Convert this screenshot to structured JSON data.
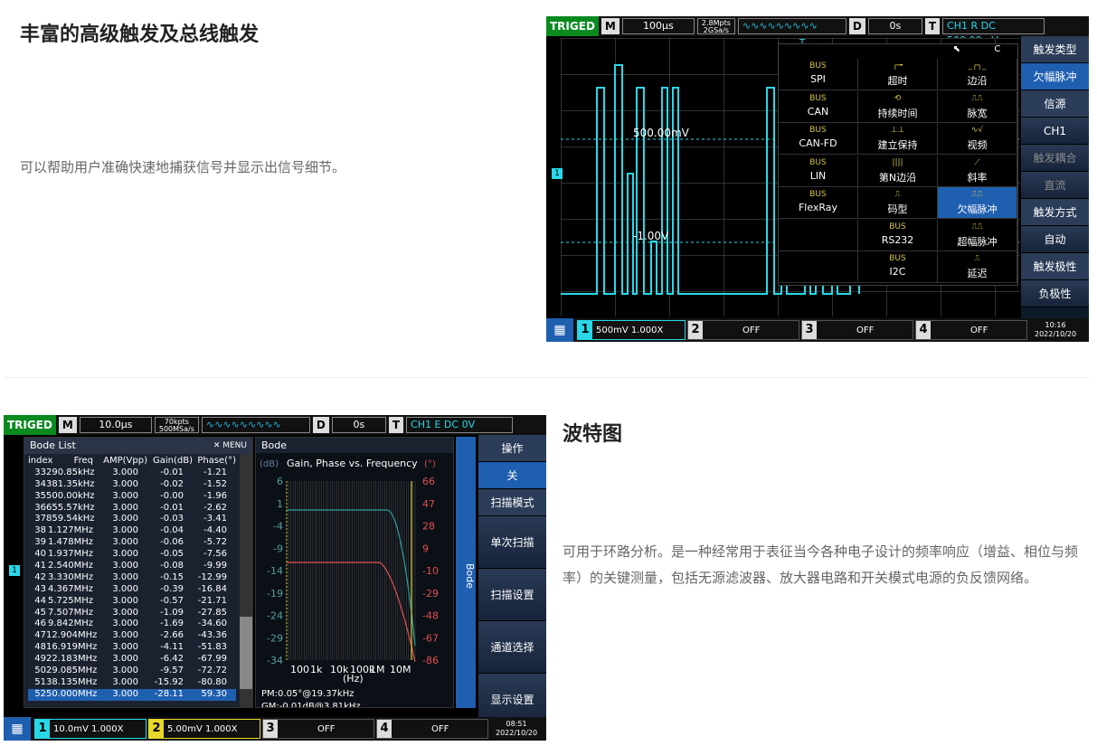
{
  "section1": {
    "title": "丰富的高级触发及总线触发",
    "desc": "可以帮助用户准确快速地捕获信号并显示出信号细节。"
  },
  "section2": {
    "title": "波特图",
    "desc": "可用于环路分析。是一种经常用于表征当今各种电子设计的频率响应（增益、相位与频率）的关键测量，包括无源滤波器、放大器电路和开关模式电源的负反馈网络。"
  },
  "scope1": {
    "top": {
      "status": "TRIGED",
      "mode": "M",
      "timebase": "100µs",
      "mem": "2.8Mpts",
      "rate": "2GSa/s",
      "delay_label": "D",
      "delay": "0s",
      "trig_label": "T",
      "trig_info": "CH1 R DC 500.00mV"
    },
    "levels": {
      "upper": "500.00mV",
      "lower": "-1.00V"
    },
    "menu_top": [
      "⬉",
      "C"
    ],
    "menu_items": [
      {
        "icon": "BUS",
        "label": "SPI"
      },
      {
        "icon": "┌╼",
        "label": "超时"
      },
      {
        "icon": "_┌┐_",
        "label": "边沿"
      },
      {
        "icon": "BUS",
        "label": "CAN"
      },
      {
        "icon": "⟲",
        "label": "持续时间"
      },
      {
        "icon": "⎍⎍",
        "label": "脉宽"
      },
      {
        "icon": "BUS",
        "label": "CAN-FD"
      },
      {
        "icon": "⊥⊥",
        "label": "建立保持"
      },
      {
        "icon": "∿√",
        "label": "视频"
      },
      {
        "icon": "BUS",
        "label": "LIN"
      },
      {
        "icon": "||||",
        "label": "第N边沿"
      },
      {
        "icon": "⟋",
        "label": "斜率"
      },
      {
        "icon": "BUS",
        "label": "FlexRay"
      },
      {
        "icon": "⎍",
        "label": "码型"
      },
      {
        "icon": "⎍⎍",
        "label": "欠幅脉冲",
        "selected": true
      },
      {
        "icon": "",
        "label": ""
      },
      {
        "icon": "BUS",
        "label": "RS232"
      },
      {
        "icon": "⎍⎍",
        "label": "超幅脉冲"
      },
      {
        "icon": "",
        "label": ""
      },
      {
        "icon": "BUS",
        "label": "I2C"
      },
      {
        "icon": "⎍",
        "label": "延迟"
      }
    ],
    "side": [
      {
        "t": "触发类型",
        "k": "h"
      },
      {
        "t": "欠幅脉冲",
        "k": "a"
      },
      {
        "t": "信源",
        "k": "h"
      },
      {
        "t": "CH1",
        "k": ""
      },
      {
        "t": "触发耦合",
        "k": "d"
      },
      {
        "t": "直流",
        "k": "d"
      },
      {
        "t": "触发方式",
        "k": "h"
      },
      {
        "t": "自动",
        "k": ""
      },
      {
        "t": "触发极性",
        "k": "h"
      },
      {
        "t": "负极性",
        "k": ""
      }
    ],
    "bottom": {
      "ch1": "500mV 1.000X",
      "ch2": "OFF",
      "ch3": "OFF",
      "ch4": "OFF",
      "time": "10:16",
      "date": "2022/10/20"
    }
  },
  "scope2": {
    "top": {
      "status": "TRIGED",
      "mode": "M",
      "timebase": "10.0µs",
      "mem": "70kpts",
      "rate": "500MSa/s",
      "delay_label": "D",
      "delay": "0s",
      "trig_label": "T",
      "trig_info": "CH1 E DC 0V"
    },
    "list_title": "Bode List",
    "menu_label": "MENU",
    "cols": [
      "index",
      "Freq",
      "AMP(Vpp)",
      "Gain(dB)",
      "Phase(°)"
    ],
    "rows": [
      [
        "33",
        "290.85kHz",
        "3.000",
        "-0.01",
        "-1.21"
      ],
      [
        "34",
        "381.35kHz",
        "3.000",
        "-0.02",
        "-1.52"
      ],
      [
        "35",
        "500.00kHz",
        "3.000",
        "-0.00",
        "-1.96"
      ],
      [
        "36",
        "655.57kHz",
        "3.000",
        "-0.01",
        "-2.62"
      ],
      [
        "37",
        "859.54kHz",
        "3.000",
        "-0.03",
        "-3.41"
      ],
      [
        "38",
        "1.127MHz",
        "3.000",
        "-0.04",
        "-4.40"
      ],
      [
        "39",
        "1.478MHz",
        "3.000",
        "-0.06",
        "-5.72"
      ],
      [
        "40",
        "1.937MHz",
        "3.000",
        "-0.05",
        "-7.56"
      ],
      [
        "41",
        "2.540MHz",
        "3.000",
        "-0.08",
        "-9.99"
      ],
      [
        "42",
        "3.330MHz",
        "3.000",
        "-0.15",
        "-12.99"
      ],
      [
        "43",
        "4.367MHz",
        "3.000",
        "-0.39",
        "-16.84"
      ],
      [
        "44",
        "5.725MHz",
        "3.000",
        "-0.57",
        "-21.71"
      ],
      [
        "45",
        "7.507MHz",
        "3.000",
        "-1.09",
        "-27.85"
      ],
      [
        "46",
        "9.842MHz",
        "3.000",
        "-1.69",
        "-34.60"
      ],
      [
        "47",
        "12.904MHz",
        "3.000",
        "-2.66",
        "-43.36"
      ],
      [
        "48",
        "16.919MHz",
        "3.000",
        "-4.11",
        "-51.83"
      ],
      [
        "49",
        "22.183MHz",
        "3.000",
        "-6.42",
        "-67.99"
      ],
      [
        "50",
        "29.085MHz",
        "3.000",
        "-9.57",
        "-72.72"
      ],
      [
        "51",
        "38.135MHz",
        "3.000",
        "-15.92",
        "-80.80"
      ],
      [
        "52",
        "50.000MHz",
        "3.000",
        "-28.11",
        "59.30"
      ]
    ],
    "bode_title": "Bode",
    "chart_title": "Gain, Phase vs. Frequency",
    "left_unit": "(dB)",
    "right_unit": "(°)",
    "left_ticks": [
      "6",
      "1",
      "-4",
      "-9",
      "-14",
      "-19",
      "-24",
      "-29",
      "-34"
    ],
    "right_ticks": [
      "66",
      "47",
      "28",
      "9",
      "-10",
      "-29",
      "-48",
      "-67",
      "-86"
    ],
    "x_ticks": [
      "100",
      "1k",
      "10k",
      "100k",
      "1M",
      "10M"
    ],
    "x_unit": "(Hz)",
    "pm": "PM:0.05°@19.37kHz",
    "gm": "GM:-0.01dB@3.81kHz",
    "side": [
      {
        "t": "操作",
        "k": "h"
      },
      {
        "t": "关",
        "k": "a"
      },
      {
        "t": "扫描模式",
        "k": "h"
      },
      {
        "t": "单次扫描",
        "k": ""
      },
      {
        "t": "扫描设置",
        "k": ""
      },
      {
        "t": "通道选择",
        "k": ""
      },
      {
        "t": "显示设置",
        "k": ""
      }
    ],
    "bottom": {
      "ch1": "10.0mV 1.000X",
      "ch2": "5.00mV 1.000X",
      "ch3": "OFF",
      "ch4": "OFF",
      "time": "08:51",
      "date": "2022/10/20"
    }
  }
}
